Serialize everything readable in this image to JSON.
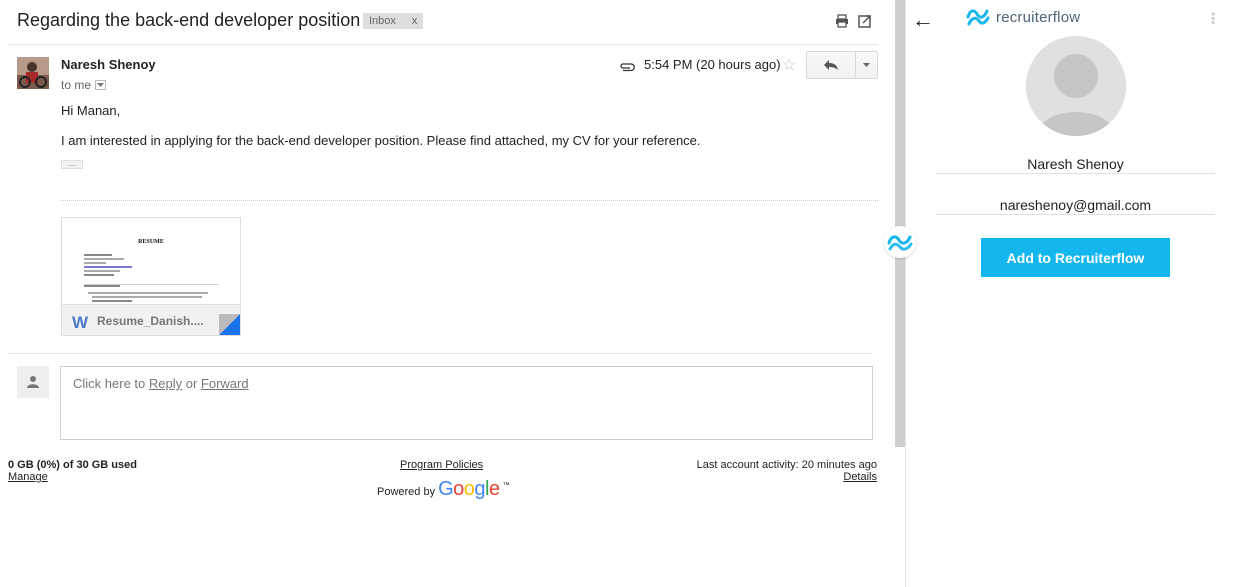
{
  "email": {
    "subject": "Regarding the back-end developer position",
    "label": "Inbox",
    "label_remove": "x",
    "sender_name": "Naresh Shenoy",
    "recipient": "to me",
    "timestamp": "5:54 PM (20 hours ago)",
    "greeting": "Hi Manan,",
    "body": "I am interested in applying for the back-end developer position. Please find attached, my CV for your reference.",
    "trimmed_content": "...",
    "attachment": {
      "name": "Resume_Danish....",
      "preview_title": "RESUME",
      "type_icon": "W"
    },
    "reply_prompt": {
      "prefix": "Click here to ",
      "reply": "Reply",
      "middle": " or ",
      "forward": "Forward"
    }
  },
  "footer": {
    "storage": "0 GB (0%) of 30 GB used",
    "manage": "Manage",
    "program_policies": "Program Policies",
    "powered_by": "Powered by",
    "google": "Google",
    "trademark": "™",
    "last_activity": "Last account activity: 20 minutes ago",
    "details": "Details"
  },
  "panel": {
    "brand": "recruiterflow",
    "back": "←",
    "candidate_name": "Naresh Shenoy",
    "candidate_email": "nareshenoy@gmail.com",
    "add_button": "Add to Recruiterflow"
  },
  "colors": {
    "brand_blue": "#14b6ee",
    "google_blue": "#4285f4",
    "google_red": "#ea4335",
    "google_yellow": "#fbbc05",
    "google_green": "#34a853"
  },
  "icons": [
    "print-icon",
    "new-window-icon",
    "paperclip-icon",
    "star-icon",
    "reply-icon",
    "chevron-down-icon",
    "word-doc-icon",
    "person-icon",
    "back-arrow-icon",
    "recruiterflow-logo-icon",
    "kebab-menu-icon"
  ]
}
